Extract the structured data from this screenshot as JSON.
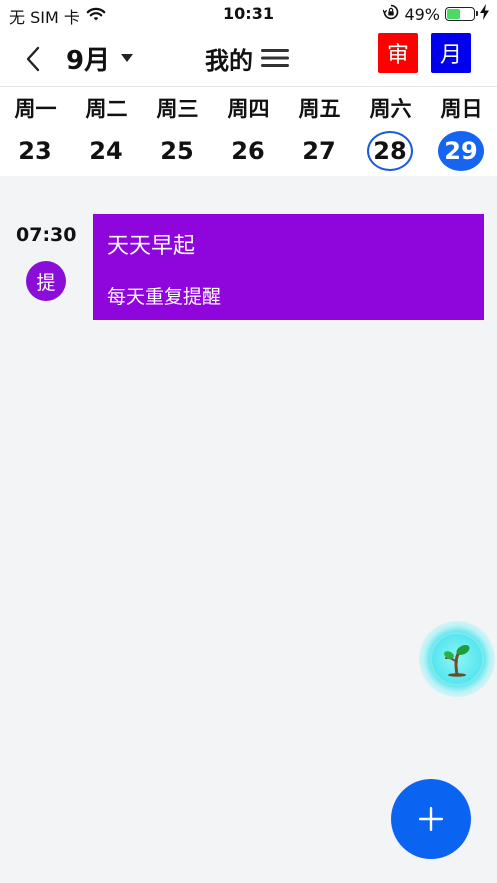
{
  "status_bar": {
    "carrier": "无 SIM 卡",
    "time": "10:31",
    "battery_percent": "49%",
    "battery_level": 0.49,
    "icons": [
      "wifi-icon",
      "rotation-lock-icon",
      "battery-icon",
      "charging-icon"
    ]
  },
  "header": {
    "month": "9月",
    "title": "我的",
    "review_button": "审",
    "month_button": "月",
    "colors": {
      "review": "#ff0000",
      "month": "#0000ee"
    }
  },
  "week": {
    "days": [
      {
        "name": "周一",
        "date": "23"
      },
      {
        "name": "周二",
        "date": "24"
      },
      {
        "name": "周三",
        "date": "25"
      },
      {
        "name": "周四",
        "date": "26"
      },
      {
        "name": "周五",
        "date": "27"
      },
      {
        "name": "周六",
        "date": "28",
        "state": "ring"
      },
      {
        "name": "周日",
        "date": "29",
        "state": "selected"
      }
    ],
    "accent": "#1565f0"
  },
  "events": [
    {
      "time": "07:30",
      "badge": "提",
      "title": "天天早起",
      "subtitle": "每天重复提醒",
      "color": "#8f06dc"
    }
  ],
  "fab": {
    "add_symbol": "+",
    "icons": [
      "sprout-icon",
      "plus-icon"
    ]
  }
}
